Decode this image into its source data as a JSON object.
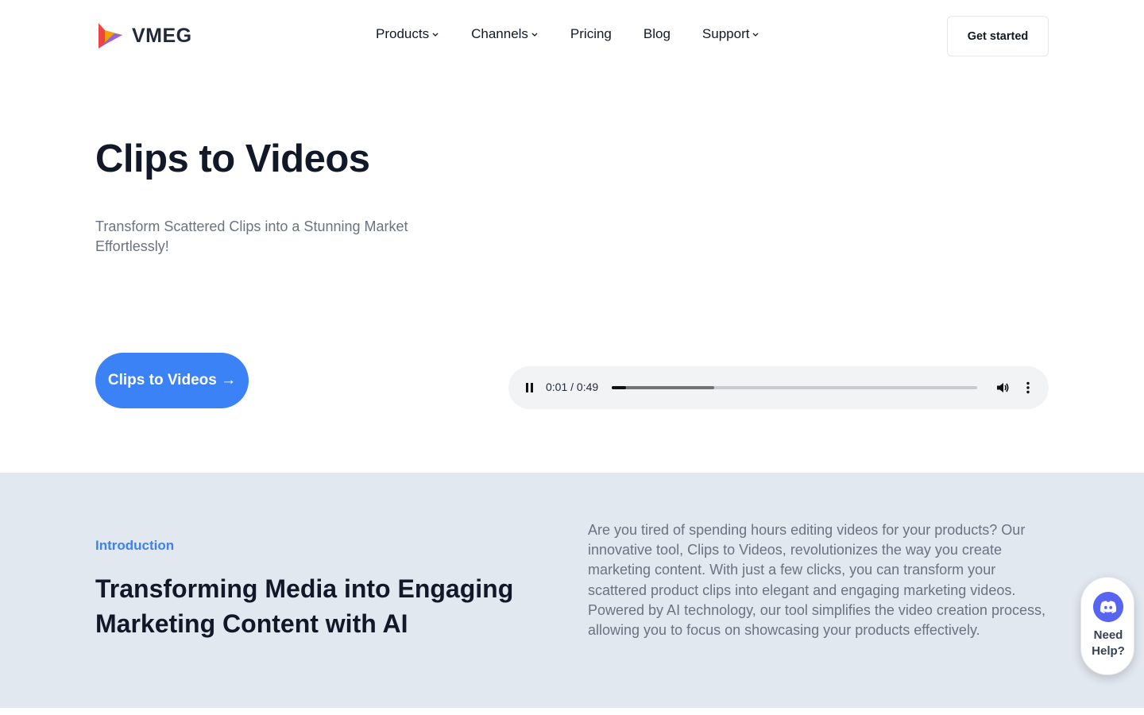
{
  "brand": {
    "name": "VMEG",
    "logo_icon": "vmeg-play-logo-icon"
  },
  "nav": {
    "items": [
      {
        "label": "Products",
        "dropdown": true
      },
      {
        "label": "Channels",
        "dropdown": true
      },
      {
        "label": "Pricing",
        "dropdown": false
      },
      {
        "label": "Blog",
        "dropdown": false
      },
      {
        "label": "Support",
        "dropdown": true
      }
    ],
    "cta_label": "Get started"
  },
  "hero": {
    "title": "Clips to Videos",
    "subtitle": "Transform Scattered Clips into a Stunning Market Effortlessly!",
    "cta_label": "Clips to Videos →"
  },
  "player": {
    "time": "0:01 / 0:49",
    "state": "playing",
    "progress_fraction": 0.04,
    "buffered_fraction": 0.28,
    "icons": [
      "pause-icon",
      "volume-icon",
      "more-vertical-icon"
    ]
  },
  "intro": {
    "eyebrow": "Introduction",
    "title": "Transforming Media into Engaging Marketing Content with AI",
    "body": "Are you tired of spending hours editing videos for your products? Our innovative tool, Clips to Videos, revolutionizes the way you create marketing content. With just a few clicks, you can transform your scattered product clips into elegant and engaging marketing videos. Powered by AI technology, our tool simplifies the video creation process, allowing you to focus on showcasing your products effectively."
  },
  "help_widget": {
    "label": "Need Help?",
    "icon": "discord-icon"
  },
  "colors": {
    "accent": "#3b82f6",
    "text": "#111827",
    "muted": "#6b7280",
    "section_bg": "#e2e8f0",
    "discord": "#5865f2"
  }
}
